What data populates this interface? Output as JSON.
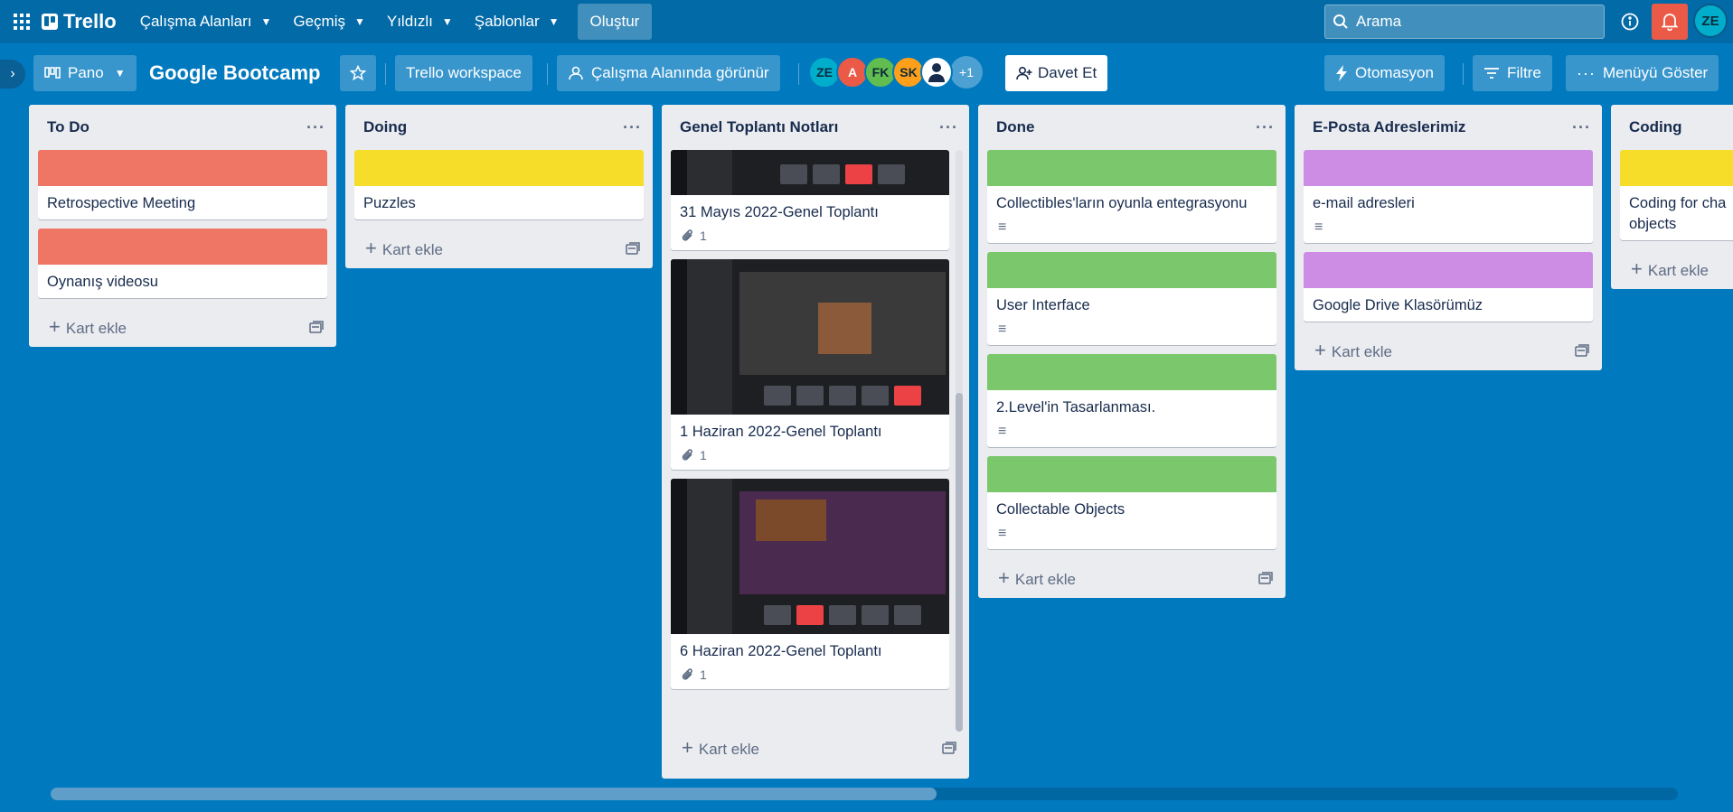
{
  "topnav": {
    "logo": "Trello",
    "menus": [
      {
        "label": "Çalışma Alanları"
      },
      {
        "label": "Geçmiş"
      },
      {
        "label": "Yıldızlı"
      },
      {
        "label": "Şablonlar"
      }
    ],
    "create_label": "Oluştur",
    "search_placeholder": "Arama",
    "user_initials": "ZE"
  },
  "board": {
    "view_label": "Pano",
    "title": "Google Bootcamp",
    "workspace_label": "Trello workspace",
    "visibility_label": "Çalışma Alanında görünür",
    "members": [
      {
        "initials": "ZE",
        "color": "#00aecc"
      },
      {
        "initials": "A",
        "color": "#eb5a46"
      },
      {
        "initials": "FK",
        "color": "#61bd4f"
      },
      {
        "initials": "SK",
        "color": "#ff9f1a"
      }
    ],
    "more_members": "+1",
    "invite_label": "Davet Et",
    "automation_label": "Otomasyon",
    "filter_label": "Filtre",
    "menu_label": "Menüyü Göster"
  },
  "lists": [
    {
      "title": "To Do",
      "cards": [
        {
          "title": "Retrospective Meeting",
          "cover": "#ef7564"
        },
        {
          "title": "Oynanış videosu",
          "cover": "#ef7564"
        }
      ],
      "add_label": "Kart ekle"
    },
    {
      "title": "Doing",
      "cards": [
        {
          "title": "Puzzles",
          "cover": "#f5dd29"
        }
      ],
      "add_label": "Kart ekle"
    },
    {
      "title": "Genel Toplantı Notları",
      "cards": [
        {
          "title": "31 Mayıs 2022-Genel Toplantı",
          "attachments": "1"
        },
        {
          "title": "1 Haziran 2022-Genel Toplantı",
          "attachments": "1"
        },
        {
          "title": "6 Haziran 2022-Genel Toplantı",
          "attachments": "1"
        }
      ],
      "add_label": "Kart ekle"
    },
    {
      "title": "Done",
      "cards": [
        {
          "title": "Collectibles'ların oyunla entegrasyonu",
          "cover": "#7bc86c"
        },
        {
          "title": "User Interface",
          "cover": "#7bc86c"
        },
        {
          "title": "2.Level'in Tasarlanması.",
          "cover": "#7bc86c"
        },
        {
          "title": "Collectable Objects",
          "cover": "#7bc86c"
        }
      ],
      "add_label": "Kart ekle"
    },
    {
      "title": "E-Posta Adreslerimiz",
      "cards": [
        {
          "title": "e-mail adresleri",
          "cover": "#cd8de5"
        },
        {
          "title": "Google Drive Klasörümüz",
          "cover": "#cd8de5"
        }
      ],
      "add_label": "Kart ekle"
    },
    {
      "title": "Coding",
      "cards": [
        {
          "title": "Coding for cha objects",
          "cover": "#f5dd29"
        }
      ],
      "add_label": "Kart ekle"
    }
  ]
}
